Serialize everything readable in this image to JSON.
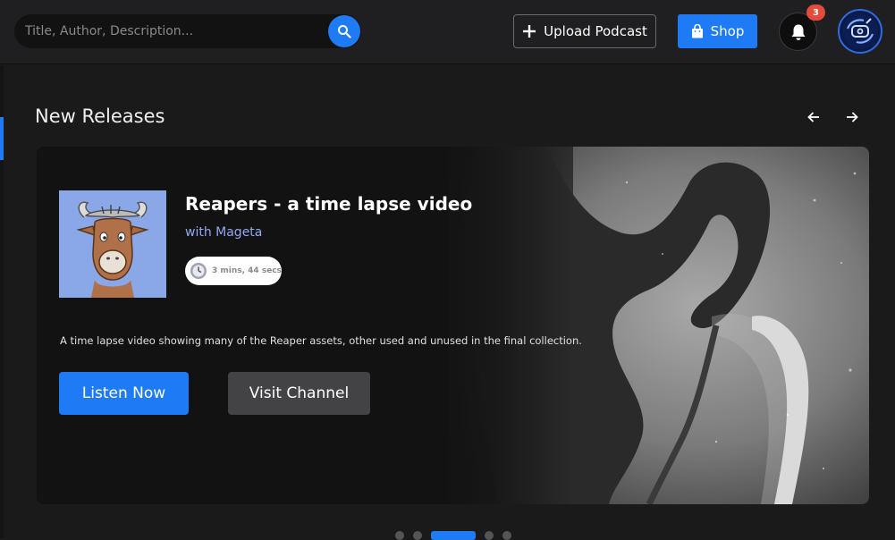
{
  "search": {
    "placeholder": "Title, Author, Description..."
  },
  "header": {
    "upload_label": "Upload Podcast",
    "shop_label": "Shop",
    "notification_count": "3"
  },
  "section": {
    "title": "New Releases"
  },
  "featured": {
    "title": "Reapers - a time lapse video",
    "host": "with Mageta",
    "duration": "3 mins, 44 secs",
    "description": "A time lapse video showing many of the Reaper assets,  other used and unused in the final collection.",
    "listen_label": "Listen Now",
    "visit_label": "Visit Channel"
  },
  "carousel": {
    "active_index": 2,
    "count": 5
  },
  "colors": {
    "accent": "#1e7bf5",
    "badge": "#e34b3a",
    "host_link": "#93a9f0"
  }
}
